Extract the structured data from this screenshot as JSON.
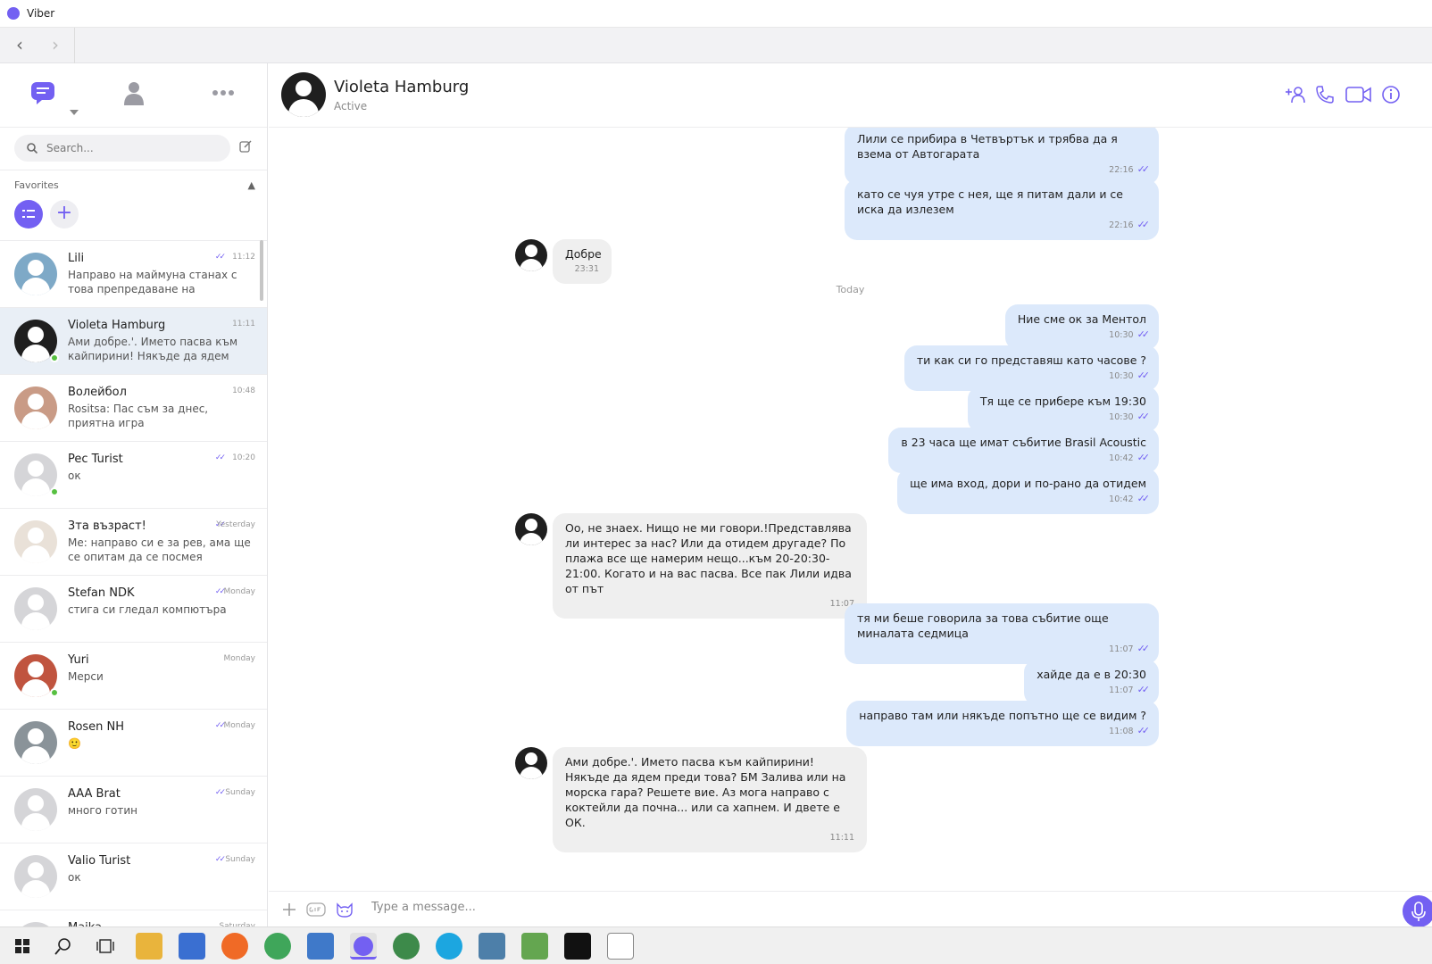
{
  "window": {
    "title": "Viber"
  },
  "search": {
    "placeholder": "Search..."
  },
  "favorites": {
    "label": "Favorites"
  },
  "chats": [
    {
      "name": "Lili",
      "time": "11:12",
      "preview": "Направо на маймуна станах с това препредаване на информа...",
      "ticks": "✓✓",
      "online": false,
      "avatar_color": "#7ea9c7"
    },
    {
      "name": "Violeta Hamburg",
      "time": "11:11",
      "preview": "Ами добре.'. Името пасва към кайпирини! Някъде да ядем пре...",
      "ticks": "",
      "online": true,
      "avatar_color": "#1f1f1f",
      "active": true
    },
    {
      "name": "Волейбол",
      "time": "10:48",
      "preview": "Rositsa: Пас съм за днес, приятна игра",
      "ticks": "",
      "online": false,
      "avatar_color": "#c99b86"
    },
    {
      "name": "Pec Turist",
      "time": "10:20",
      "preview": "ок",
      "ticks": "✓✓",
      "online": true,
      "avatar_color": "#d5d5d8"
    },
    {
      "name": "3та възраст!",
      "time": "Yesterday",
      "preview": "Me: направо си е за рев, ама ще се опитам да се посмея",
      "ticks": "✓✓",
      "online": false,
      "avatar_color": "#e9e1d8"
    },
    {
      "name": "Stefan NDK",
      "time": "Monday",
      "preview": "стига си гледал компютъра",
      "ticks": "✓✓",
      "online": false,
      "avatar_color": "#d5d5d8"
    },
    {
      "name": "Yuri",
      "time": "Monday",
      "preview": "Мерси",
      "ticks": "",
      "online": true,
      "avatar_color": "#c0543f"
    },
    {
      "name": "Rosen NH",
      "time": "Monday",
      "preview": "🙂",
      "ticks": "✓✓",
      "online": false,
      "avatar_color": "#8a9399"
    },
    {
      "name": "AAA Brat",
      "time": "Sunday",
      "preview": "много готин",
      "ticks": "✓✓",
      "online": false,
      "avatar_color": "#d5d5d8"
    },
    {
      "name": "Valio Turist",
      "time": "Sunday",
      "preview": "ок",
      "ticks": "✓✓",
      "online": false,
      "avatar_color": "#d5d5d8"
    },
    {
      "name": "Maika",
      "time": "Saturday",
      "preview": "",
      "ticks": "",
      "online": false,
      "avatar_color": "#d5d5d8"
    }
  ],
  "conversation": {
    "name": "Violeta Hamburg",
    "status": "Active",
    "day_separator": "Today",
    "messages": [
      {
        "dir": "out",
        "text": "Лили се прибира в Четвъртък и трябва да я взема от Автогарата",
        "time": "22:16"
      },
      {
        "dir": "out",
        "text": "като се чуя утре с нея, ще я питам дали и се иска да излезем",
        "time": "22:16"
      },
      {
        "dir": "in",
        "text": "Добре",
        "time": "23:31"
      },
      {
        "dir": "out",
        "text": "Ние сме ок за Ментол",
        "time": "10:30"
      },
      {
        "dir": "out",
        "text": "ти как си го представяш като часове ?",
        "time": "10:30"
      },
      {
        "dir": "out",
        "text": "Тя ще се прибере към 19:30",
        "time": "10:30"
      },
      {
        "dir": "out",
        "text": "в 23 часа ще имат събитие Brasil Acoustic",
        "time": "10:42"
      },
      {
        "dir": "out",
        "text": "ще има вход, дори и по-рано да отидем",
        "time": "10:42"
      },
      {
        "dir": "in",
        "text": "Оо, не знаех. Нищо не ми говори.!Представлява ли интерес за нас? Или да отидем другаде? По плажа все ще намерим нещо...към 20-20:30-21:00. Когато и на вас пасва. Все пак Лили идва от път",
        "time": "11:07"
      },
      {
        "dir": "out",
        "text": "тя ми беше говорила за това събитие още миналата седмица",
        "time": "11:07"
      },
      {
        "dir": "out",
        "text": "хайде да е в 20:30",
        "time": "11:07"
      },
      {
        "dir": "out",
        "text": "направо там или някъде попътно ще се видим ?",
        "time": "11:08"
      },
      {
        "dir": "in",
        "text": "Ами добре.'. Името пасва към кайпирини! Някъде да ядем преди това? БМ Залива или на морска гара? Решете вие. Аз мога направо с коктейли да почна... или са хапнем. И двете е ОК.",
        "time": "11:11"
      }
    ]
  },
  "composer": {
    "placeholder": "Type a message..."
  },
  "colors": {
    "accent": "#7360f2",
    "outgoing": "#dce9fb",
    "incoming": "#efefef"
  }
}
